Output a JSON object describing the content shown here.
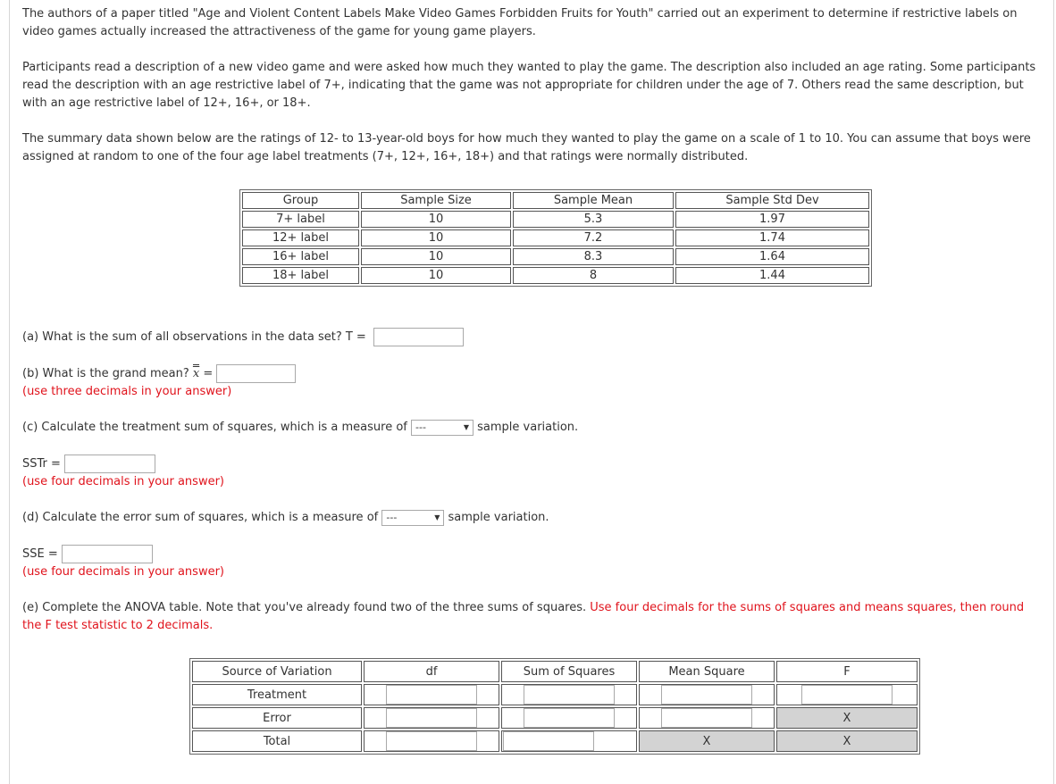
{
  "intro": {
    "para1": "The authors of a paper titled \"Age and Violent Content Labels Make Video Games Forbidden Fruits for Youth\" carried out an experiment to determine if restrictive labels on video games actually increased the attractiveness of the game for young game players.",
    "para2": "Participants read a description of a new video game and were asked how much they wanted to play the game. The description also included an age rating. Some participants read the description with an age restrictive label of 7+, indicating that the game was not appropriate for children under the age of 7. Others read the same description, but with an age restrictive label of 12+, 16+, or 18+.",
    "para3": "The summary data shown below are the ratings of 12- to 13-year-old boys for how much they wanted to play the game on a scale of 1 to 10. You can assume that boys were assigned at random to one of the four age label treatments (7+, 12+, 16+, 18+) and that ratings were normally distributed."
  },
  "summary_table": {
    "headers": [
      "Group",
      "Sample Size",
      "Sample Mean",
      "Sample Std Dev"
    ],
    "rows": [
      [
        "7+ label",
        "10",
        "5.3",
        "1.97"
      ],
      [
        "12+ label",
        "10",
        "7.2",
        "1.74"
      ],
      [
        "16+ label",
        "10",
        "8.3",
        "1.64"
      ],
      [
        "18+ label",
        "10",
        "8",
        "1.44"
      ]
    ]
  },
  "part_a": {
    "question": "(a) What is the sum of all observations in the data set? T =",
    "value": ""
  },
  "part_b": {
    "question": "(b) What is the grand mean?",
    "symbol": "x",
    "equals": "=",
    "value": "",
    "hint": "(use three decimals in your answer)"
  },
  "part_c": {
    "question": "(c) Calculate the treatment sum of squares, which is a measure of",
    "select_value": "---",
    "suffix": "sample variation.",
    "label": "SSTr =",
    "value": "",
    "hint": "(use four decimals in your answer)"
  },
  "part_d": {
    "question": "(d) Calculate the error sum of squares, which is a measure of",
    "select_value": "---",
    "suffix": "sample variation.",
    "label": "SSE =",
    "value": "",
    "hint": "(use four decimals in your answer)"
  },
  "part_e": {
    "text": "(e) Complete the ANOVA table. Note that you've already found two of the three sums of squares.",
    "red_text": "Use four decimals for the sums of squares and means squares, then round the F test statistic to 2 decimals."
  },
  "anova_table": {
    "headers": [
      "Source of Variation",
      "df",
      "Sum of Squares",
      "Mean Square",
      "F"
    ],
    "rows": [
      {
        "source": "Treatment"
      },
      {
        "source": "Error",
        "f": "X"
      },
      {
        "source": "Total",
        "ms": "X",
        "f": "X"
      }
    ]
  }
}
